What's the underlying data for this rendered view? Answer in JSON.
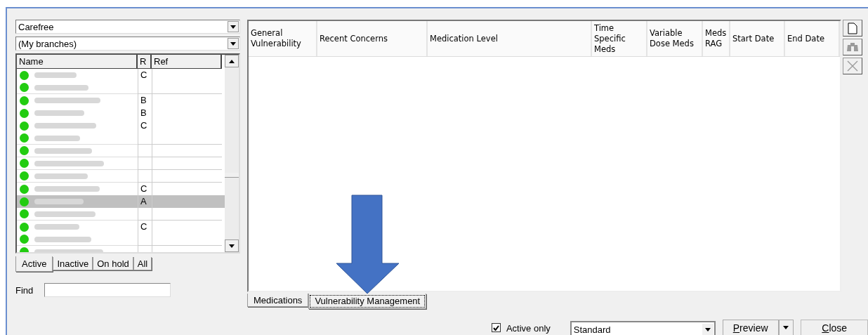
{
  "client_filter": {
    "value": "Carefree"
  },
  "branch_filter": {
    "value": "(My branches)"
  },
  "client_list": {
    "columns": [
      "Name",
      "R",
      "Ref"
    ],
    "rows": [
      {
        "rag": "C",
        "selected": false
      },
      {
        "rag": "",
        "selected": false
      },
      {
        "rag": "B",
        "selected": false
      },
      {
        "rag": "B",
        "selected": false
      },
      {
        "rag": "C",
        "selected": false
      },
      {
        "rag": "",
        "selected": false
      },
      {
        "rag": "",
        "selected": false
      },
      {
        "rag": "",
        "selected": false
      },
      {
        "rag": "",
        "selected": false
      },
      {
        "rag": "C",
        "selected": false
      },
      {
        "rag": "A",
        "selected": true
      },
      {
        "rag": "",
        "selected": false
      },
      {
        "rag": "C",
        "selected": false
      },
      {
        "rag": "",
        "selected": false
      },
      {
        "rag": "",
        "selected": false
      }
    ]
  },
  "status_tabs": [
    {
      "label": "Active",
      "selected": true
    },
    {
      "label": "Inactive",
      "selected": false
    },
    {
      "label": "On hold",
      "selected": false
    },
    {
      "label": "All",
      "selected": false
    }
  ],
  "find": {
    "label": "Find"
  },
  "grid": {
    "columns": [
      "General Vulnerability",
      "Recent Concerns",
      "Medication Level",
      "Time Specific Meds",
      "Variable Dose Meds",
      "Meds RAG",
      "Start Date",
      "End Date"
    ]
  },
  "toolbar": [
    {
      "kind": "new",
      "disabled": false
    },
    {
      "kind": "find",
      "disabled": true
    },
    {
      "kind": "delete",
      "disabled": true
    }
  ],
  "view_tabs": [
    {
      "label": "Medications",
      "selected": false
    },
    {
      "label": "Vulnerability Management",
      "selected": true
    }
  ],
  "annotation": {
    "kind": "down-arrow"
  },
  "footer": {
    "active_only": {
      "label": "Active only",
      "checked": true
    },
    "report": {
      "value": "Standard"
    },
    "preview": {
      "label": "Preview",
      "access_key": true
    },
    "close": {
      "label": "Close",
      "access_key": true
    }
  }
}
